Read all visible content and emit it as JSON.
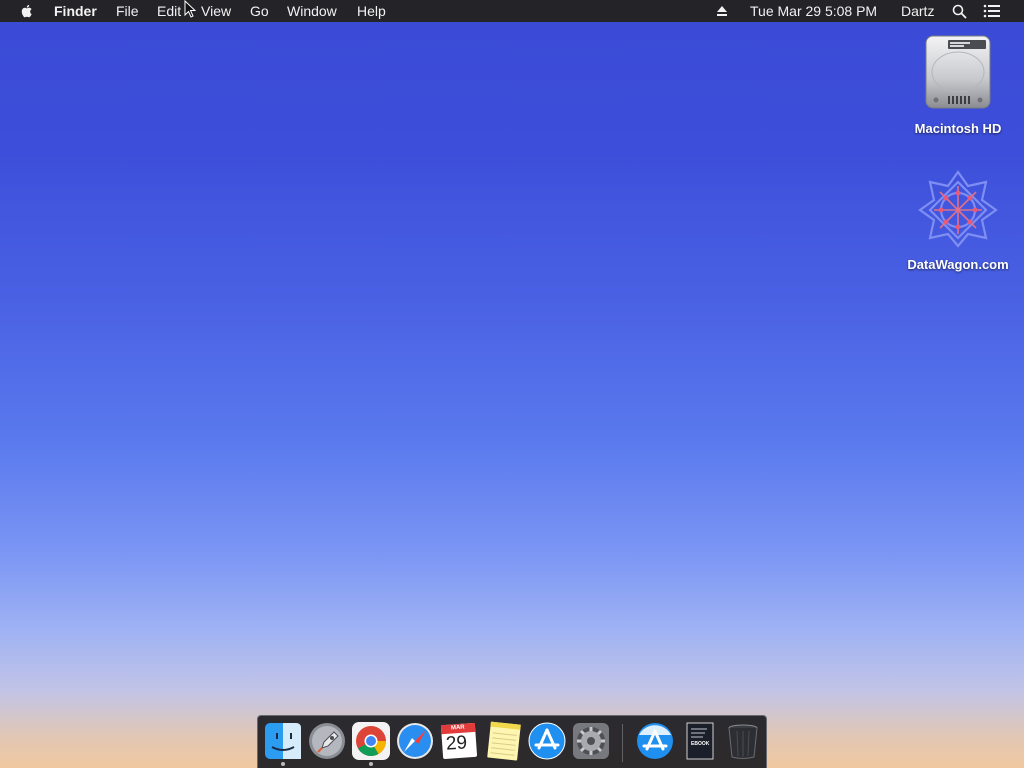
{
  "menubar": {
    "apple_icon": "apple-logo-icon",
    "app_name": "Finder",
    "menus": [
      "File",
      "Edit",
      "View",
      "Go",
      "Window",
      "Help"
    ],
    "eject_icon": "eject-icon",
    "datetime": "Tue Mar 29  5:08 PM",
    "user": "Dartz",
    "search_icon": "spotlight-search-icon",
    "notification_icon": "notification-center-icon"
  },
  "desktop": {
    "icons": [
      {
        "label": "Macintosh HD",
        "icon": "hard-drive-icon"
      },
      {
        "label": "DataWagon.com",
        "icon": "network-volume-icon"
      }
    ]
  },
  "dock": {
    "items": [
      {
        "app": "Finder",
        "icon": "finder-icon",
        "running": true
      },
      {
        "app": "Launchpad",
        "icon": "launchpad-rocket-icon",
        "running": false
      },
      {
        "app": "Google Chrome",
        "icon": "chrome-icon",
        "running": true
      },
      {
        "app": "Safari",
        "icon": "safari-compass-icon",
        "running": false
      },
      {
        "app": "Calendar",
        "icon": "calendar-icon",
        "running": false,
        "month": "MAR",
        "day": "29"
      },
      {
        "app": "Notes",
        "icon": "notes-icon",
        "running": false
      },
      {
        "app": "App Store",
        "icon": "app-store-icon",
        "running": false
      },
      {
        "app": "System Preferences",
        "icon": "system-preferences-gear-icon",
        "running": false
      },
      {
        "app": "App Store",
        "icon": "app-store-download-icon",
        "running": false
      },
      {
        "app": "Ebook",
        "icon": "ebook-document-icon",
        "running": false,
        "cover_text": "EBOOK"
      },
      {
        "app": "Trash",
        "icon": "trash-icon",
        "running": false
      }
    ]
  },
  "colors": {
    "menubar_bg": "#242428",
    "wallpaper_top": "#3a4ad6",
    "wallpaper_bottom": "#f0c8a0"
  }
}
